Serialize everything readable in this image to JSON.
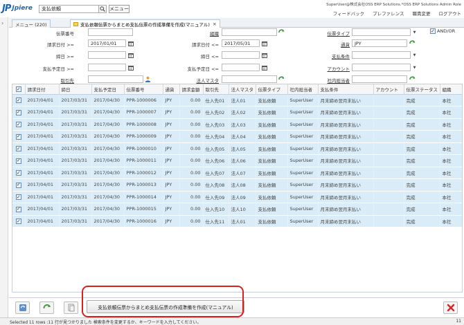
{
  "header": {
    "logo_jp": "JP",
    "logo_text": "Jpiere",
    "search_value": "支払依頼",
    "menu_label": "メニュー",
    "user_info": "SuperUser@株式会社OSS ERP Solutions.*OSS ERP Solutions Admin Role",
    "links": [
      "フィードバック",
      "プレファレンス",
      "職責変更",
      "ログアウト"
    ]
  },
  "tabs": {
    "menu_tab": "メニュー (220)",
    "active_tab": "支払依頼伝票からまとめ支払伝票の作成準備を作成(マニュアル)"
  },
  "form": {
    "doc_no_label": "伝票番号",
    "invoice_date_from_label": "請求日付 >=",
    "invoice_date_from": "2017/01/01",
    "due_date_from_label": "締日 >=",
    "pay_date_from_label": "支払予定日 >=",
    "partner_label": "取引先",
    "org_label": "組織",
    "invoice_date_to_label": "請求日付 <=",
    "invoice_date_to": "2017/05/31",
    "due_date_to_label": "締日 <=",
    "pay_date_to_label": "支払予定日 <=",
    "corp_master_label": "法人マスタ",
    "doc_type_label": "伝票タイプ",
    "currency_label": "通貨",
    "currency_value": "JPY",
    "payment_term_label": "支払条件",
    "account_label": "アカウント",
    "sales_rep_label": "社内担当者",
    "andor_label": "AND/OR"
  },
  "grid": {
    "columns": [
      "請求日付",
      "締日",
      "支払予定日",
      "伝票番号",
      "通貨",
      "請求金額",
      "取引先",
      "法人マスタ",
      "伝票タイプ",
      "社内担当者",
      "支払条件",
      "アカウント",
      "伝票ステータス",
      "組織"
    ],
    "rows": [
      [
        "2017/04/01",
        "2017/03/31",
        "2017/04/30",
        "PPR-1000006",
        "JPY",
        "0.00",
        "仕入先01",
        "法人01",
        "支払依頼",
        "SuperUser",
        "月末締め翌月末払い",
        "",
        "完成",
        "本社"
      ],
      [
        "2017/04/01",
        "2017/03/31",
        "2017/04/30",
        "PPR-1000007",
        "JPY",
        "0.00",
        "仕入先02",
        "法人02",
        "支払依頼",
        "SuperUser",
        "月末締め翌月末払い",
        "",
        "完成",
        "本社"
      ],
      [
        "2017/04/01",
        "2017/03/31",
        "2017/04/30",
        "PPR-1000008",
        "JPY",
        "0.00",
        "仕入先03",
        "法人03",
        "支払依頼",
        "SuperUser",
        "月末締め翌月末払い",
        "",
        "完成",
        "本社"
      ],
      [
        "2017/04/01",
        "2017/03/31",
        "2017/04/30",
        "PPR-1000009",
        "JPY",
        "0.00",
        "仕入先04",
        "法人04",
        "支払依頼",
        "SuperUser",
        "月末締め翌月末払い",
        "",
        "完成",
        "本社"
      ],
      [
        "2017/04/01",
        "2017/03/31",
        "2017/04/30",
        "PPR-1000010",
        "JPY",
        "0.00",
        "仕入先05",
        "法人05",
        "支払依頼",
        "SuperUser",
        "月末締め翌月末払い",
        "",
        "完成",
        "本社"
      ],
      [
        "2017/04/01",
        "2017/03/31",
        "2017/04/30",
        "PPR-1000011",
        "JPY",
        "0.00",
        "仕入先06",
        "法人06",
        "支払依頼",
        "SuperUser",
        "月末締め翌月末払い",
        "",
        "完成",
        "本社"
      ],
      [
        "2017/04/01",
        "2017/03/31",
        "2017/04/30",
        "PPR-1000012",
        "JPY",
        "0.00",
        "仕入先07",
        "法人07",
        "支払依頼",
        "SuperUser",
        "月末締め翌月末払い",
        "",
        "完成",
        "本社"
      ],
      [
        "2017/04/01",
        "2017/03/31",
        "2017/04/30",
        "PPR-1000013",
        "JPY",
        "0.00",
        "仕入先08",
        "法人08",
        "支払依頼",
        "SuperUser",
        "月末締め翌月末払い",
        "",
        "完成",
        "本社"
      ],
      [
        "2017/04/01",
        "2017/03/31",
        "2017/04/30",
        "PPR-1000014",
        "JPY",
        "0.00",
        "仕入先09",
        "法人09",
        "支払依頼",
        "SuperUser",
        "月末締め翌月末払い",
        "",
        "完成",
        "本社"
      ],
      [
        "2017/04/01",
        "2017/03/31",
        "2017/04/30",
        "PPR-1000015",
        "JPY",
        "0.00",
        "仕入先10",
        "法人10",
        "支払依頼",
        "SuperUser",
        "月末締め翌月末払い",
        "",
        "完成",
        "本社"
      ],
      [
        "2017/04/01",
        "2017/03/31",
        "2017/04/30",
        "PPR-1000016",
        "JPY",
        "0.00",
        "仕入先11",
        "法人01",
        "支払依頼",
        "SuperUser",
        "月末締め翌月末払い",
        "",
        "完成",
        "本社"
      ]
    ]
  },
  "footer": {
    "process_button": "支払依頼伝票からまとめ支払伝票の作成準備を作成(マニュアル)",
    "status_text": "Selected 11 rows :11 行が見つかりました  検索条件を変更するか、キーワードを入力してください。",
    "status_count": "11"
  },
  "colors": {
    "row_bg": "#d9ecf7",
    "accent": "#1a66b0",
    "highlight": "#d62020"
  }
}
